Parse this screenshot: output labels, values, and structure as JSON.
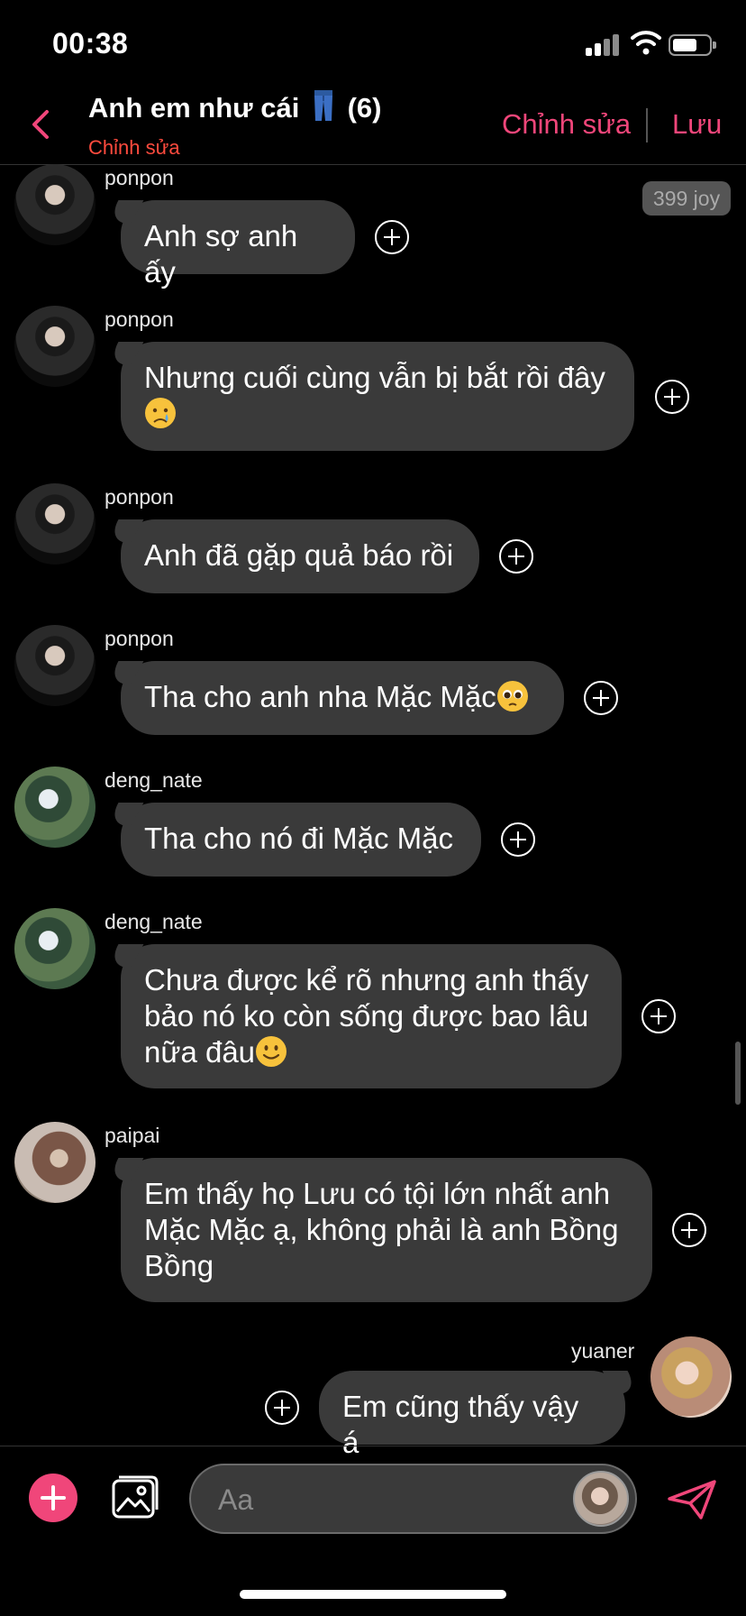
{
  "status_bar": {
    "time": "00:38"
  },
  "header": {
    "title_prefix": "Anh em như cái",
    "title_count": "(6)",
    "subtitle": "Chỉnh sửa",
    "edit_label": "Chỉnh sửa",
    "save_label": "Lưu"
  },
  "joy_badge": "399 joy",
  "messages": [
    {
      "sender": "ponpon",
      "lines": [
        "Anh sợ anh ấy"
      ]
    },
    {
      "sender": "ponpon",
      "lines": [
        "Nhưng cuối cùng vẫn bị bắt rồi đây"
      ],
      "emoji": "crying-face"
    },
    {
      "sender": "ponpon",
      "lines": [
        "Anh đã gặp quả báo rồi"
      ]
    },
    {
      "sender": "ponpon",
      "lines": [
        "Tha cho anh nha Mặc Mặc"
      ],
      "emoji": "pleading-face"
    },
    {
      "sender": "deng_nate",
      "lines": [
        "Tha cho nó đi Mặc Mặc"
      ]
    },
    {
      "sender": "deng_nate",
      "lines": [
        "Chưa được kể rõ nhưng anh thấy",
        "bảo nó ko còn sống được bao lâu",
        "nữa đâu"
      ],
      "emoji": "slightly-smiling-face"
    },
    {
      "sender": "paipai",
      "lines": [
        "Em thấy họ Lưu có tội lớn nhất anh",
        "Mặc Mặc ạ, không phải là anh Bồng",
        "Bồng"
      ]
    },
    {
      "sender": "yuaner",
      "lines": [
        "Em cũng thấy vậy á"
      ]
    }
  ],
  "composer": {
    "placeholder": "Aa"
  },
  "colors": {
    "accent": "#f0467a",
    "subtitle": "#ff4b3e",
    "bubble": "#3a3a3a",
    "background": "#000000"
  }
}
